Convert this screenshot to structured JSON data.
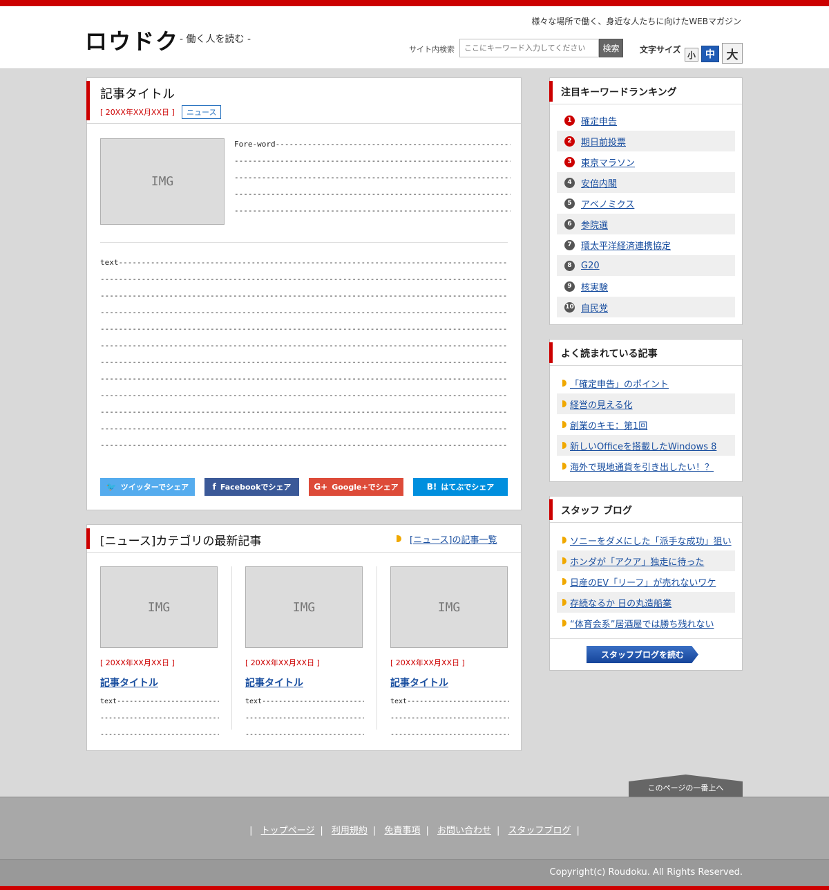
{
  "header": {
    "logo": "ロウドク",
    "tagline": "- 働く人を読む -",
    "catch": "様々な場所で働く、身近な人たちに向けたWEBマガジン",
    "search_label": "サイト内検索",
    "search_placeholder": "ここにキーワード入力してください",
    "search_button": "検索",
    "size_label": "文字サイズ",
    "size_small": "小",
    "size_medium": "中",
    "size_large": "大"
  },
  "article": {
    "title": "記事タイトル",
    "date": "[ 20XX年XX月XX日 ]",
    "category": "ニュース",
    "img": "IMG",
    "foreword": "Fore-word------------------------------------------------------\n----------------------------------------------------------------\n----------------------------------------------------------------\n----------------------------------------------------------------\n----------------------------------------------------------------",
    "text": "text----------------------------------------------------------------------------------------------------------\n----------------------------------------------------------------------------------------------------------------\n----------------------------------------------------------------------------------------------------------------\n----------------------------------------------------------------------------------------------------------------\n----------------------------------------------------------------------------------------------------------------\n----------------------------------------------------------------------------------------------------------------\n----------------------------------------------------------------------------------------------------------------\n----------------------------------------------------------------------------------------------------------------\n----------------------------------------------------------------------------------------------------------------\n----------------------------------------------------------------------------------------------------------------\n----------------------------------------------------------------------------------------------------------------\n----------------------------------------------------------------------------------------------------------------",
    "share": {
      "twitter": "ツイッターでシェア",
      "facebook": "Facebookでシェア",
      "google": "Google+でシェア",
      "hatena": "はてぶでシェア"
    }
  },
  "category": {
    "title": "[ニュース]カテゴリの最新記事",
    "link": "[ニュース]の記事一覧",
    "items": [
      {
        "img": "IMG",
        "date": "[ 20XX年XX月XX日 ]",
        "title": "記事タイトル",
        "text": "text---------------------------\n--------------------------------\n-----------------------------..."
      },
      {
        "img": "IMG",
        "date": "[ 20XX年XX月XX日 ]",
        "title": "記事タイトル",
        "text": "text---------------------------\n--------------------------------\n-----------------------------..."
      },
      {
        "img": "IMG",
        "date": "[ 20XX年XX月XX日 ]",
        "title": "記事タイトル",
        "text": "text---------------------------\n--------------------------------\n-----------------------------..."
      }
    ]
  },
  "ranking": {
    "title": "注目キーワードランキング",
    "items": [
      {
        "num": "1",
        "label": "確定申告"
      },
      {
        "num": "2",
        "label": "期日前投票"
      },
      {
        "num": "3",
        "label": "東京マラソン"
      },
      {
        "num": "4",
        "label": "安倍内閣"
      },
      {
        "num": "5",
        "label": "アベノミクス"
      },
      {
        "num": "6",
        "label": "参院選"
      },
      {
        "num": "7",
        "label": "環太平洋経済連携協定"
      },
      {
        "num": "8",
        "label": "G20"
      },
      {
        "num": "9",
        "label": "核実験"
      },
      {
        "num": "10",
        "label": "自民党"
      }
    ]
  },
  "popular": {
    "title": "よく読まれている記事",
    "items": [
      "「確定申告」のポイント",
      "経営の見える化",
      "創業のキモ：第1回",
      "新しいOfficeを搭載したWindows 8",
      "海外で現地通貨を引き出したい！？"
    ]
  },
  "staff_blog": {
    "title": "スタッフ ブログ",
    "items": [
      "ソニーをダメにした「派手な成功」狙い",
      "ホンダが「アクア」独走に待った",
      "日産のEV「リーフ」が売れないワケ",
      "存続なるか 日の丸造船業",
      "“体育会系”居酒屋では勝ち残れない"
    ],
    "button": "スタッフブログを読む"
  },
  "totop": "このページの一番上へ",
  "footer": {
    "links": [
      "トップページ",
      "利用規約",
      "免責事項",
      "お問い合わせ",
      "スタッフブログ"
    ],
    "copyright": "Copyright(c) Roudoku. All Rights Reserved."
  },
  "colors": {
    "accent": "#cc0000",
    "link": "#1a4fa0",
    "bullet": "#f0a800",
    "twitter": "#55acee",
    "facebook": "#3b5998",
    "google": "#dd4b39",
    "hatena": "#008fde"
  }
}
